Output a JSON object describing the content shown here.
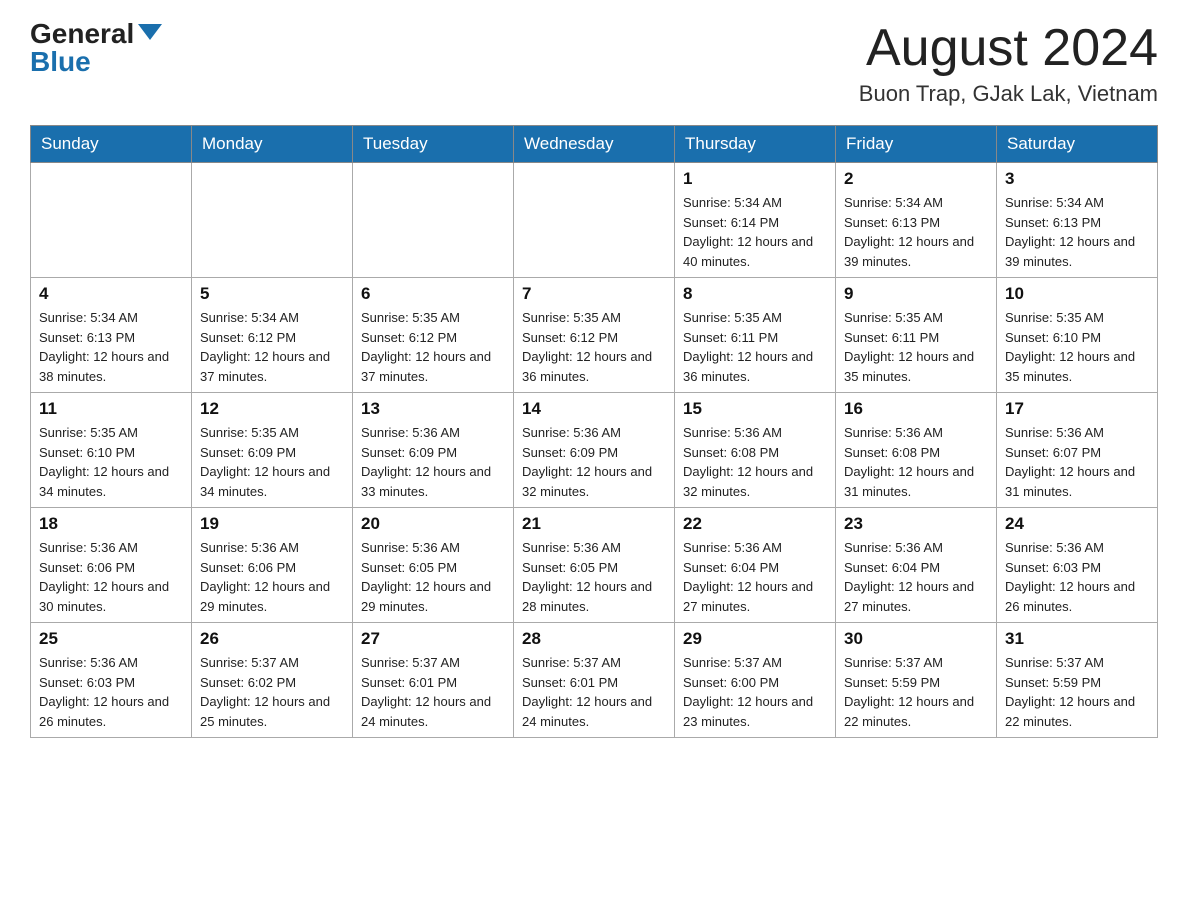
{
  "header": {
    "logo_general": "General",
    "logo_blue": "Blue",
    "month_title": "August 2024",
    "location": "Buon Trap, GJak Lak, Vietnam"
  },
  "days_of_week": [
    "Sunday",
    "Monday",
    "Tuesday",
    "Wednesday",
    "Thursday",
    "Friday",
    "Saturday"
  ],
  "weeks": [
    [
      {
        "day": "",
        "info": ""
      },
      {
        "day": "",
        "info": ""
      },
      {
        "day": "",
        "info": ""
      },
      {
        "day": "",
        "info": ""
      },
      {
        "day": "1",
        "info": "Sunrise: 5:34 AM\nSunset: 6:14 PM\nDaylight: 12 hours and 40 minutes."
      },
      {
        "day": "2",
        "info": "Sunrise: 5:34 AM\nSunset: 6:13 PM\nDaylight: 12 hours and 39 minutes."
      },
      {
        "day": "3",
        "info": "Sunrise: 5:34 AM\nSunset: 6:13 PM\nDaylight: 12 hours and 39 minutes."
      }
    ],
    [
      {
        "day": "4",
        "info": "Sunrise: 5:34 AM\nSunset: 6:13 PM\nDaylight: 12 hours and 38 minutes."
      },
      {
        "day": "5",
        "info": "Sunrise: 5:34 AM\nSunset: 6:12 PM\nDaylight: 12 hours and 37 minutes."
      },
      {
        "day": "6",
        "info": "Sunrise: 5:35 AM\nSunset: 6:12 PM\nDaylight: 12 hours and 37 minutes."
      },
      {
        "day": "7",
        "info": "Sunrise: 5:35 AM\nSunset: 6:12 PM\nDaylight: 12 hours and 36 minutes."
      },
      {
        "day": "8",
        "info": "Sunrise: 5:35 AM\nSunset: 6:11 PM\nDaylight: 12 hours and 36 minutes."
      },
      {
        "day": "9",
        "info": "Sunrise: 5:35 AM\nSunset: 6:11 PM\nDaylight: 12 hours and 35 minutes."
      },
      {
        "day": "10",
        "info": "Sunrise: 5:35 AM\nSunset: 6:10 PM\nDaylight: 12 hours and 35 minutes."
      }
    ],
    [
      {
        "day": "11",
        "info": "Sunrise: 5:35 AM\nSunset: 6:10 PM\nDaylight: 12 hours and 34 minutes."
      },
      {
        "day": "12",
        "info": "Sunrise: 5:35 AM\nSunset: 6:09 PM\nDaylight: 12 hours and 34 minutes."
      },
      {
        "day": "13",
        "info": "Sunrise: 5:36 AM\nSunset: 6:09 PM\nDaylight: 12 hours and 33 minutes."
      },
      {
        "day": "14",
        "info": "Sunrise: 5:36 AM\nSunset: 6:09 PM\nDaylight: 12 hours and 32 minutes."
      },
      {
        "day": "15",
        "info": "Sunrise: 5:36 AM\nSunset: 6:08 PM\nDaylight: 12 hours and 32 minutes."
      },
      {
        "day": "16",
        "info": "Sunrise: 5:36 AM\nSunset: 6:08 PM\nDaylight: 12 hours and 31 minutes."
      },
      {
        "day": "17",
        "info": "Sunrise: 5:36 AM\nSunset: 6:07 PM\nDaylight: 12 hours and 31 minutes."
      }
    ],
    [
      {
        "day": "18",
        "info": "Sunrise: 5:36 AM\nSunset: 6:06 PM\nDaylight: 12 hours and 30 minutes."
      },
      {
        "day": "19",
        "info": "Sunrise: 5:36 AM\nSunset: 6:06 PM\nDaylight: 12 hours and 29 minutes."
      },
      {
        "day": "20",
        "info": "Sunrise: 5:36 AM\nSunset: 6:05 PM\nDaylight: 12 hours and 29 minutes."
      },
      {
        "day": "21",
        "info": "Sunrise: 5:36 AM\nSunset: 6:05 PM\nDaylight: 12 hours and 28 minutes."
      },
      {
        "day": "22",
        "info": "Sunrise: 5:36 AM\nSunset: 6:04 PM\nDaylight: 12 hours and 27 minutes."
      },
      {
        "day": "23",
        "info": "Sunrise: 5:36 AM\nSunset: 6:04 PM\nDaylight: 12 hours and 27 minutes."
      },
      {
        "day": "24",
        "info": "Sunrise: 5:36 AM\nSunset: 6:03 PM\nDaylight: 12 hours and 26 minutes."
      }
    ],
    [
      {
        "day": "25",
        "info": "Sunrise: 5:36 AM\nSunset: 6:03 PM\nDaylight: 12 hours and 26 minutes."
      },
      {
        "day": "26",
        "info": "Sunrise: 5:37 AM\nSunset: 6:02 PM\nDaylight: 12 hours and 25 minutes."
      },
      {
        "day": "27",
        "info": "Sunrise: 5:37 AM\nSunset: 6:01 PM\nDaylight: 12 hours and 24 minutes."
      },
      {
        "day": "28",
        "info": "Sunrise: 5:37 AM\nSunset: 6:01 PM\nDaylight: 12 hours and 24 minutes."
      },
      {
        "day": "29",
        "info": "Sunrise: 5:37 AM\nSunset: 6:00 PM\nDaylight: 12 hours and 23 minutes."
      },
      {
        "day": "30",
        "info": "Sunrise: 5:37 AM\nSunset: 5:59 PM\nDaylight: 12 hours and 22 minutes."
      },
      {
        "day": "31",
        "info": "Sunrise: 5:37 AM\nSunset: 5:59 PM\nDaylight: 12 hours and 22 minutes."
      }
    ]
  ]
}
